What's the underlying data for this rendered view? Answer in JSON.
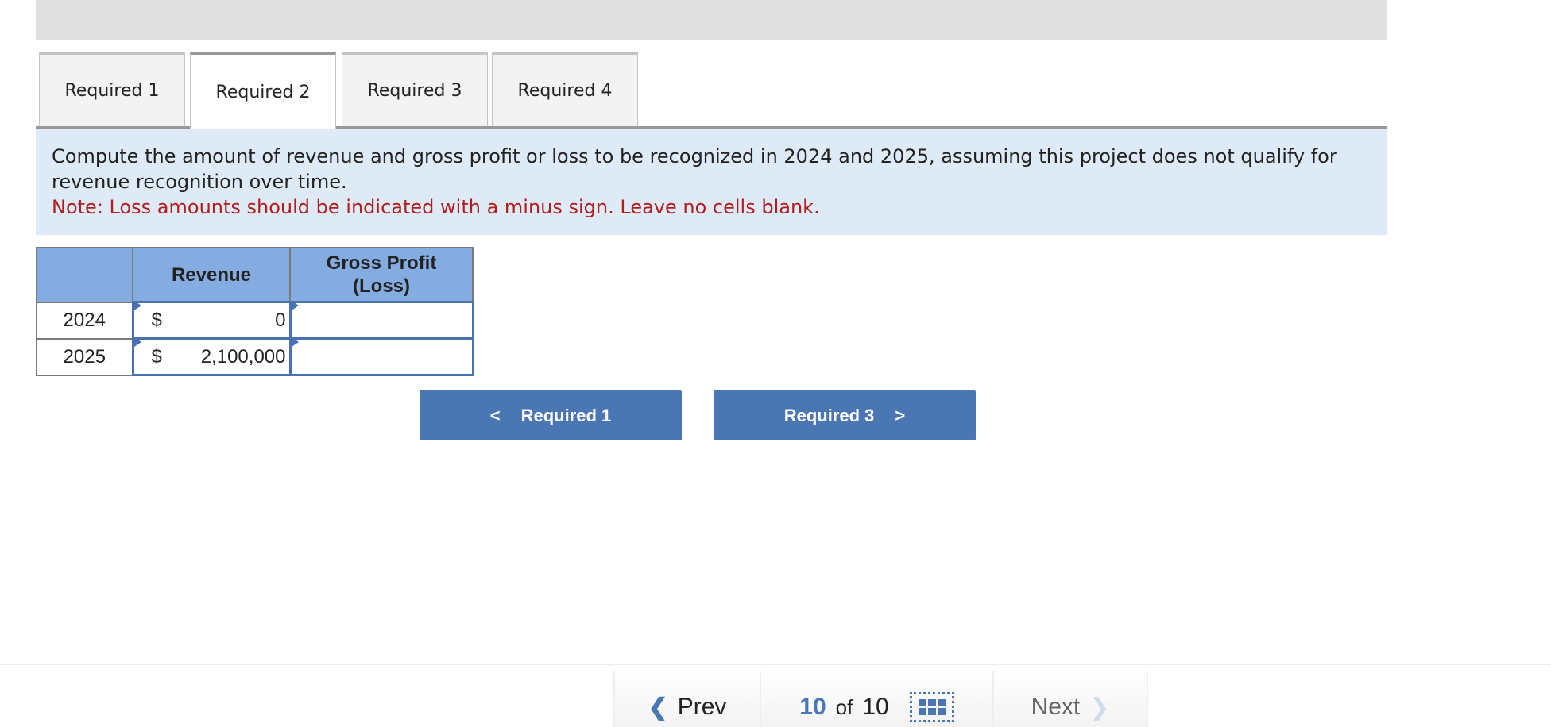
{
  "tabs": [
    {
      "label": "Required 1"
    },
    {
      "label": "Required 2",
      "active": true
    },
    {
      "label": "Required 3"
    },
    {
      "label": "Required 4"
    }
  ],
  "instructions": {
    "text": "Compute the amount of revenue and gross profit or loss to be recognized in 2024 and 2025, assuming this project does not qualify for revenue recognition over time.",
    "note": "Note: Loss amounts should be indicated with a minus sign. Leave no cells blank."
  },
  "table": {
    "headers": [
      "",
      "Revenue",
      "Gross Profit (Loss)"
    ],
    "rows": [
      {
        "year": "2024",
        "currency": "$",
        "revenue": "0",
        "gross_profit": ""
      },
      {
        "year": "2025",
        "currency": "$",
        "revenue": "2,100,000",
        "gross_profit": ""
      }
    ]
  },
  "nav": {
    "prev_label": "Required 1",
    "next_label": "Required 3",
    "prev_icon": "chevron-left-icon",
    "next_icon": "chevron-right-icon"
  },
  "footer": {
    "prev": "Prev",
    "current": "10",
    "of": "of",
    "total": "10",
    "next": "Next",
    "grid_icon": "grid-icon"
  },
  "colors": {
    "accent": "#4a76b4",
    "header": "#84ace0",
    "info_bg": "#deebf7",
    "note": "#b11e1e"
  }
}
